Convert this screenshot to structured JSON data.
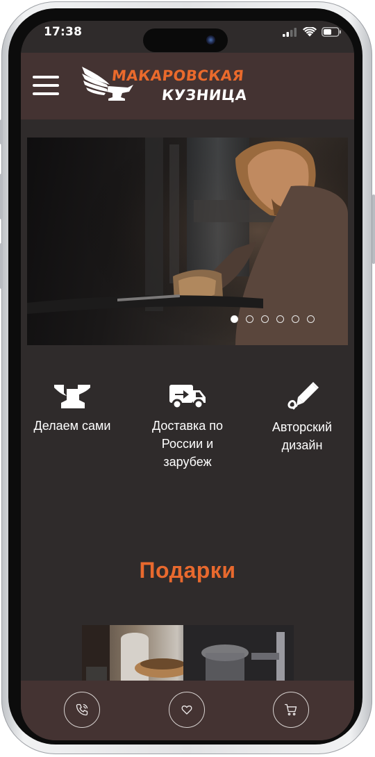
{
  "status_bar": {
    "time": "17:38"
  },
  "header": {
    "menu_icon": "hamburger-icon",
    "logo": {
      "line1": "МАКАРОВСКАЯ",
      "line2": "КУЗНИЦА"
    }
  },
  "slider": {
    "slide_count": 6,
    "active_index": 0,
    "image": "blacksmith-at-forge"
  },
  "features": [
    {
      "icon": "anvil-icon",
      "label_lines": [
        "Делаем сами"
      ]
    },
    {
      "icon": "delivery-truck-icon",
      "label_lines": [
        "Доставка по",
        "России и",
        "зарубеж"
      ]
    },
    {
      "icon": "pen-design-icon",
      "label_lines": [
        "Авторский",
        "дизайн"
      ]
    }
  ],
  "section": {
    "title": "Подарки"
  },
  "bottom_bar": [
    {
      "icon": "phone-call-icon"
    },
    {
      "icon": "heart-icon"
    },
    {
      "icon": "cart-icon"
    }
  ],
  "colors": {
    "accent": "#e8692e",
    "header_bg": "#443332",
    "page_bg": "#2f2b2b"
  }
}
